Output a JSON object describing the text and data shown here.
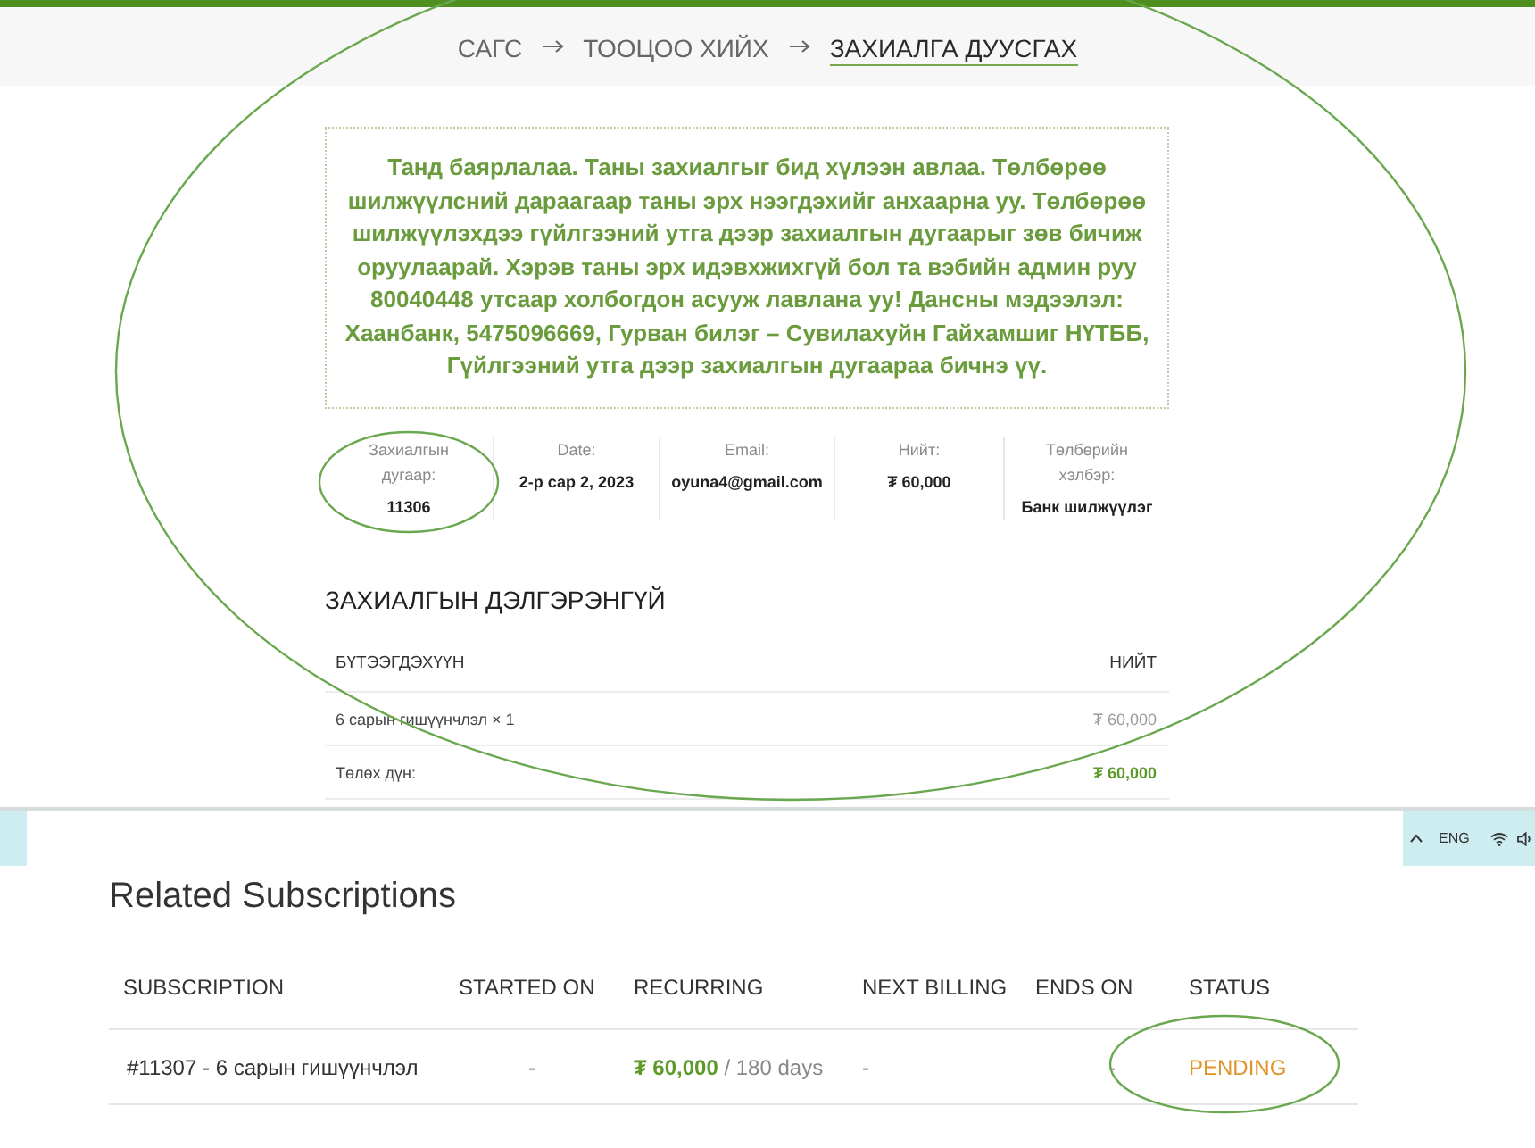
{
  "breadcrumb": [
    {
      "label": "САГС",
      "selected": false
    },
    {
      "label": "ТООЦОО ХИЙХ",
      "selected": false
    },
    {
      "label": "ЗАХИАЛГА ДУУСГАХ",
      "selected": true
    }
  ],
  "notice": "Танд баярлалаа. Таны захиалгыг бид хүлээн авлаа. Төлбөрөө шилжүүлсний дараагаар таны эрх нээгдэхийг анхаарна уу. Төлбөрөө шилжүүлэхдээ гүйлгээний утга дээр захиалгын дугаарыг зөв бичиж оруулаарай. Хэрэв таны эрх идэвхжихгүй бол та вэбийн админ руу 80040448 утсаар холбогдон асууж лавлана уу! Дансны мэдээлэл: Хаанбанк, 5475096669, Гурван билэг – Сувилахуйн Гайхамшиг НҮТББ, Гүйлгээний утга дээр захиалгын дугаараа бичнэ үү.",
  "order_overview": [
    {
      "label": "Захиалгын дугаар:",
      "value": "11306"
    },
    {
      "label": "Date:",
      "value": "2-р сар 2, 2023"
    },
    {
      "label": "Email:",
      "value": "oyuna4@gmail.com"
    },
    {
      "label": "Нийт:",
      "value": "₮ 60,000"
    },
    {
      "label": "Төлбөрийн хэлбэр:",
      "value": "Банк шилжүүлэг"
    }
  ],
  "order_details": {
    "title": "ЗАХИАЛГЫН ДЭЛГЭРЭНГҮЙ",
    "columns": [
      "БҮТЭЭГДЭХҮҮН",
      "НИЙТ"
    ],
    "rows": [
      {
        "kind": "item",
        "label": "6 сарын гишүүнчлэл × 1",
        "value": "₮ 60,000"
      },
      {
        "kind": "total",
        "label": "Төлөх дүн:",
        "value": "₮ 60,000"
      }
    ]
  },
  "taskbar": {
    "language": "ENG"
  },
  "related_subscriptions": {
    "title": "Related Subscriptions",
    "columns": [
      "SUBSCRIPTION",
      "STARTED ON",
      "RECURRING",
      "NEXT BILLING",
      "ENDS ON",
      "STATUS"
    ],
    "rows": [
      {
        "subscription": "#11307 - 6 сарын гишүүнчлэл",
        "started_on": "-",
        "recurring": "**₮ 60,000** / 180 days",
        "next_billing": "-",
        "ends_on": "-",
        "status": {
          "text": "PENDING",
          "color": "#e0952c"
        }
      }
    ]
  }
}
